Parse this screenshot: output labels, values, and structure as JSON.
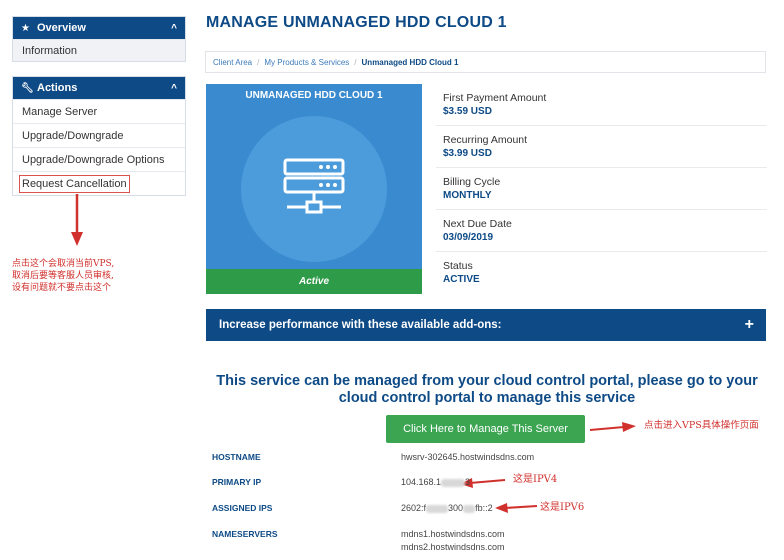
{
  "sidebar": {
    "overview": {
      "title": "Overview",
      "items": [
        "Information"
      ]
    },
    "actions": {
      "title": "Actions",
      "items": [
        "Manage Server",
        "Upgrade/Downgrade",
        "Upgrade/Downgrade Options",
        "Request Cancellation"
      ]
    }
  },
  "annotations": {
    "cancel_note": [
      "点击这个会取消当前VPS,",
      "取消后要等客服人员审核,",
      "设有问题就不要点击这个"
    ],
    "manage_note": "点击进入VPS具体操作页面",
    "ipv4_note": "这是IPV4",
    "ipv6_note": "这是IPV6"
  },
  "page": {
    "title": "MANAGE UNMANAGED HDD CLOUD 1",
    "breadcrumb": [
      "Client Area",
      "My Products & Services",
      "Unmanaged HDD Cloud 1"
    ]
  },
  "product": {
    "name": "UNMANAGED HDD CLOUD 1",
    "status": "Active",
    "icon": "server-icon"
  },
  "billing": [
    {
      "label": "First Payment Amount",
      "value": "$3.59 USD"
    },
    {
      "label": "Recurring Amount",
      "value": "$3.99 USD"
    },
    {
      "label": "Billing Cycle",
      "value": "MONTHLY"
    },
    {
      "label": "Next Due Date",
      "value": "03/09/2019"
    },
    {
      "label": "Status",
      "value": "ACTIVE"
    }
  ],
  "addons": {
    "label": "Increase performance with these available add-ons:",
    "toggle": "+"
  },
  "portal": {
    "message": "This service can be managed from your cloud control portal, please go to your cloud control portal to manage this service",
    "button": "Click Here to Manage This Server"
  },
  "details": {
    "hostname": {
      "label": "HOSTNAME",
      "value": "hwsrv-302645.hostwindsdns.com"
    },
    "primary_ip": {
      "label": "PRIMARY IP",
      "value_start": "104.168.1",
      "value_end": "3"
    },
    "assigned_ips": {
      "label": "ASSIGNED IPS",
      "value_start": "2602:f",
      "value_mid": "300",
      "value_end": "fb::2"
    },
    "nameservers": {
      "label": "NAMESERVERS",
      "values": [
        "mdns1.hostwindsdns.com",
        "mdns2.hostwindsdns.com"
      ]
    }
  },
  "colors": {
    "brand_navy": "#0d4a86",
    "card_blue": "#3a8ad0",
    "active_green": "#2e9b48",
    "button_green": "#3ba552",
    "annotation_red": "#d0312d"
  }
}
